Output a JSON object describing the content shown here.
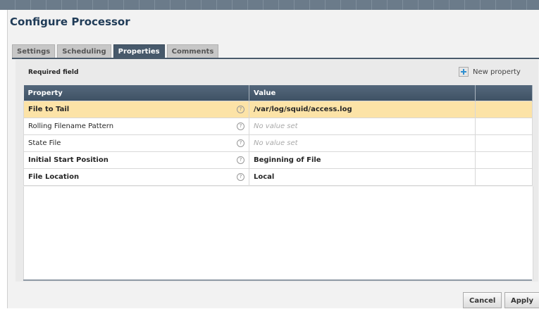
{
  "dialog": {
    "title": "Configure Processor"
  },
  "tabs": [
    {
      "label": "Settings",
      "active": false
    },
    {
      "label": "Scheduling",
      "active": false
    },
    {
      "label": "Properties",
      "active": true
    },
    {
      "label": "Comments",
      "active": false
    }
  ],
  "properties_panel": {
    "required_label": "Required field",
    "new_property_label": "New property",
    "columns": {
      "property": "Property",
      "value": "Value",
      "actions": ""
    },
    "rows": [
      {
        "name": "File to Tail",
        "value": "/var/log/squid/access.log",
        "required": true,
        "selected": true,
        "value_set": true
      },
      {
        "name": "Rolling Filename Pattern",
        "value": "No value set",
        "required": false,
        "selected": false,
        "value_set": false
      },
      {
        "name": "State File",
        "value": "No value set",
        "required": false,
        "selected": false,
        "value_set": false
      },
      {
        "name": "Initial Start Position",
        "value": "Beginning of File",
        "required": true,
        "selected": false,
        "value_set": true
      },
      {
        "name": "File Location",
        "value": "Local",
        "required": true,
        "selected": false,
        "value_set": true
      }
    ],
    "help_icon": "question-circle-icon",
    "add_icon": "plus-icon"
  },
  "footer": {
    "cancel_label": "Cancel",
    "apply_label": "Apply"
  },
  "colors": {
    "header": "#47596b",
    "selected_row": "#fce3a7",
    "title": "#1f3b57"
  }
}
